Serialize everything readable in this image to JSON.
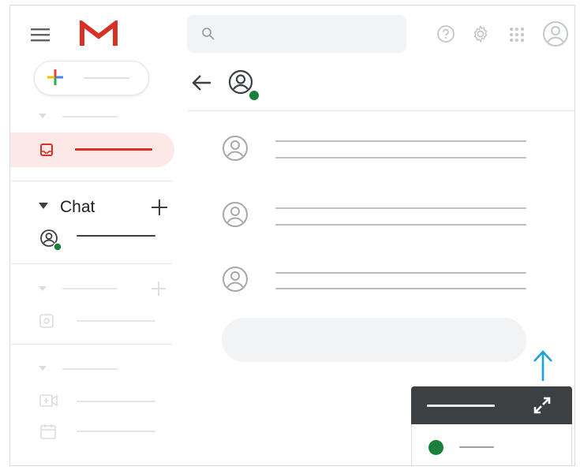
{
  "app": {
    "name": "Gmail"
  },
  "sidebar": {
    "chat_section": {
      "title": "Chat"
    }
  },
  "colors": {
    "gmail_red": "#d93025",
    "online_green": "#188038",
    "arrow_blue": "#1a9ee4",
    "popup_header": "#3c4043",
    "selected_bg": "#fce8e6"
  },
  "icons": {
    "menu": "hamburger-menu-icon",
    "logo": "gmail-logo",
    "search": "search-icon",
    "help": "help-icon",
    "settings": "settings-gear-icon",
    "apps": "apps-grid-icon",
    "account": "account-avatar-icon",
    "back": "back-arrow-icon",
    "expand": "expand-icon"
  }
}
